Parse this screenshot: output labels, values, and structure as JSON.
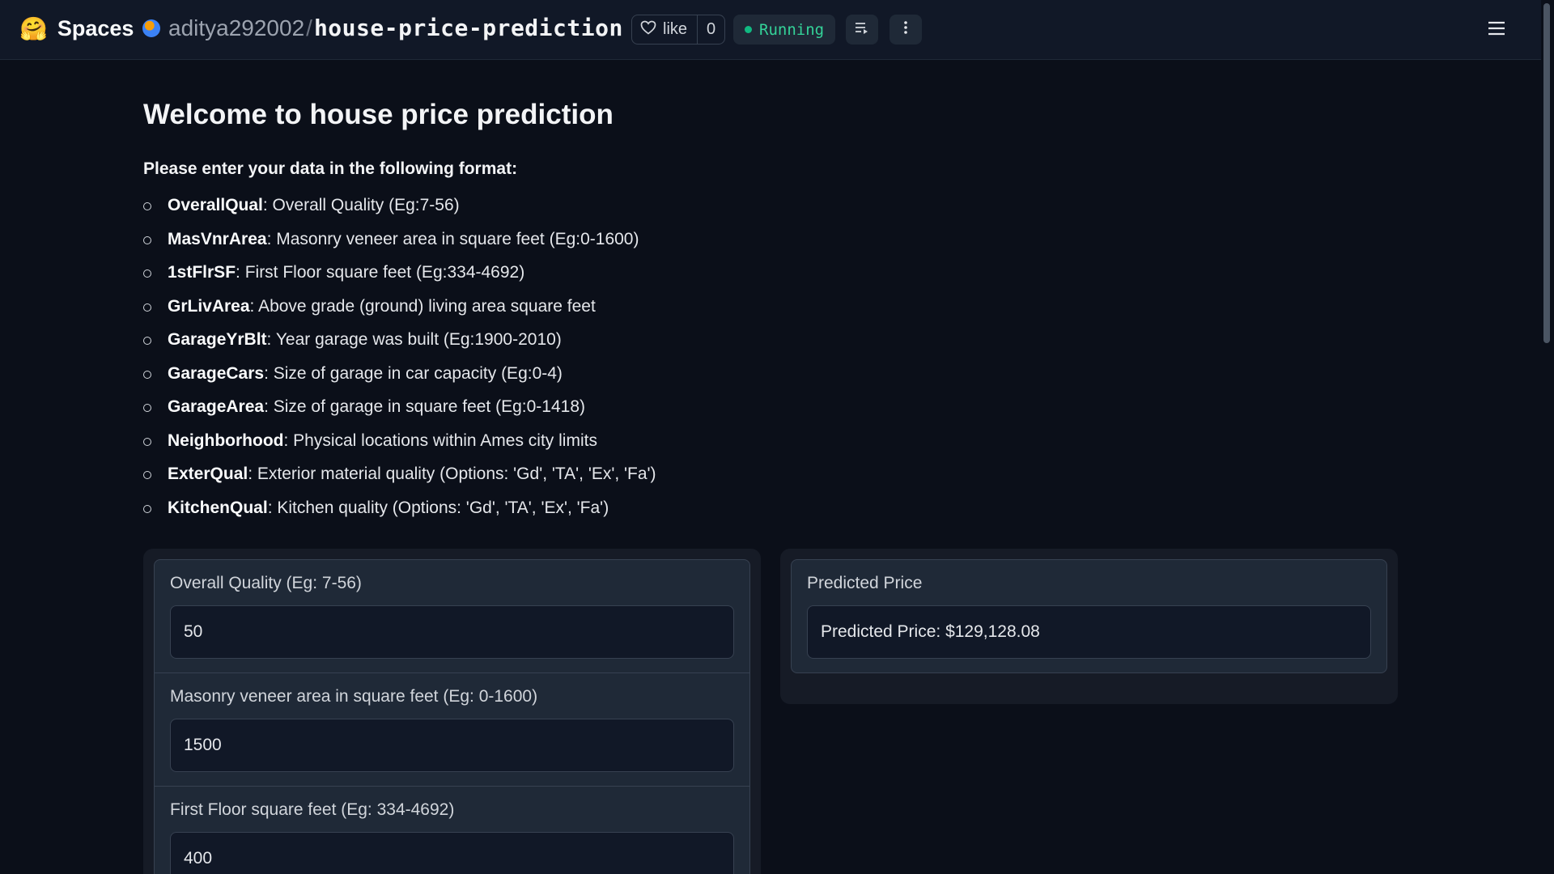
{
  "header": {
    "brand": "Spaces",
    "owner": "aditya292002",
    "separator": "/",
    "space_name": "house-price-prediction",
    "like_label": "like",
    "like_count": "0",
    "status": "Running",
    "status_color": "#10b981"
  },
  "page": {
    "title": "Welcome to house price prediction",
    "intro": "Please enter your data in the following format:",
    "fields": [
      {
        "name": "OverallQual",
        "desc": ": Overall Quality (Eg:7-56)"
      },
      {
        "name": "MasVnrArea",
        "desc": ": Masonry veneer area in square feet (Eg:0-1600)"
      },
      {
        "name": "1stFlrSF",
        "desc": ": First Floor square feet (Eg:334-4692)"
      },
      {
        "name": "GrLivArea",
        "desc": ": Above grade (ground) living area square feet"
      },
      {
        "name": "GarageYrBlt",
        "desc": ": Year garage was built (Eg:1900-2010)"
      },
      {
        "name": "GarageCars",
        "desc": ": Size of garage in car capacity (Eg:0-4)"
      },
      {
        "name": "GarageArea",
        "desc": ": Size of garage in square feet (Eg:0-1418)"
      },
      {
        "name": "Neighborhood",
        "desc": ": Physical locations within Ames city limits"
      },
      {
        "name": "ExterQual",
        "desc": ": Exterior material quality (Options: 'Gd', 'TA', 'Ex', 'Fa')"
      },
      {
        "name": "KitchenQual",
        "desc": ": Kitchen quality (Options: 'Gd', 'TA', 'Ex', 'Fa')"
      }
    ]
  },
  "form": {
    "inputs": [
      {
        "label": "Overall Quality (Eg: 7-56)",
        "value": "50"
      },
      {
        "label": "Masonry veneer area in square feet (Eg: 0-1600)",
        "value": "1500"
      },
      {
        "label": "First Floor square feet (Eg: 334-4692)",
        "value": "400"
      }
    ]
  },
  "output": {
    "label": "Predicted Price",
    "value": "Predicted Price: $129,128.08"
  },
  "icons": {
    "logo": "hugging-face-logo",
    "copy": "copy-icon",
    "like": "heart-icon",
    "queue": "queue-icon",
    "more": "more-vertical-icon",
    "menu": "hamburger-menu-icon"
  }
}
